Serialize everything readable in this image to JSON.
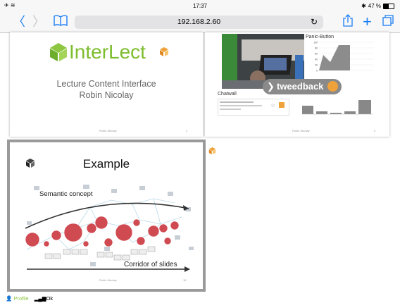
{
  "status_bar": {
    "time": "17:37",
    "battery": "47 %",
    "battery_level": 0.47
  },
  "toolbar": {
    "url": "192.168.2.60"
  },
  "slide1": {
    "logo_text": "InterLect",
    "subtitle": "Lecture Content Interface",
    "author": "Robin Nicolay",
    "footer_left": "Robin Nicolay",
    "page": "2"
  },
  "slide2": {
    "chart_title": "Panic-Button",
    "chat_title": "Chatwall",
    "tweedback": "tweedback",
    "footer_left": "Robin Nicolay",
    "page": "3",
    "chart_data": {
      "type": "area",
      "title": "Panic-Button",
      "y_ticks": [
        0,
        20,
        40,
        60,
        80,
        100
      ],
      "ylim": [
        0,
        100
      ]
    }
  },
  "slide3": {
    "title": "Example",
    "semantic_label": "Semantic concept",
    "corridor_label": "Corridor of slides",
    "footer_left": "Robin Nicolay",
    "page": "18"
  },
  "bottom_bar": {
    "profile": "Profile",
    "ok": "Ok"
  },
  "colors": {
    "accent": "#1a7ef5",
    "logo_green": "#8dc63f",
    "logo_orange": "#f0a23a"
  }
}
